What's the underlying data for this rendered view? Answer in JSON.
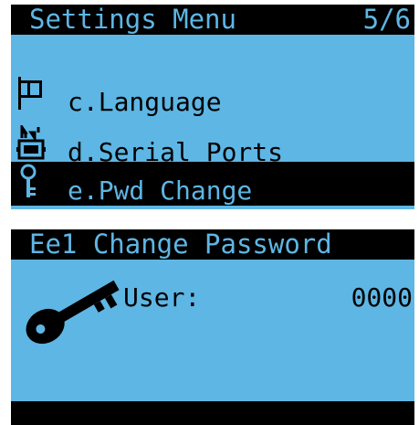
{
  "top_screen": {
    "title": "Settings Menu",
    "page_indicator": "5/6",
    "items": [
      {
        "label": "c.Language",
        "icon": "flag-icon",
        "selected": false
      },
      {
        "label": "d.Serial Ports",
        "icon": "serial-port-icon",
        "selected": false
      },
      {
        "label": "e.Pwd Change",
        "icon": "key-icon",
        "selected": true
      }
    ]
  },
  "bottom_screen": {
    "title": "Ee1 Change Password",
    "field_label": "User:",
    "field_value": "0000",
    "icon": "key-icon"
  },
  "colors": {
    "lcd_background": "#5eb6e4",
    "lcd_foreground": "#000000"
  }
}
